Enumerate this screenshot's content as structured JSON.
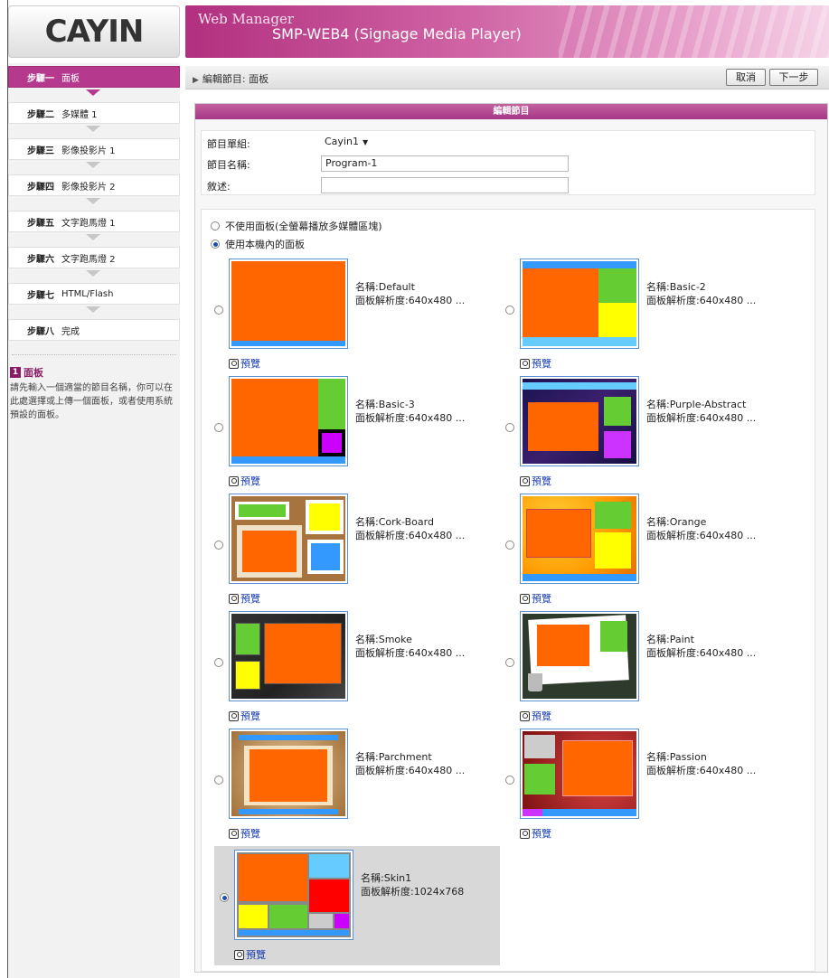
{
  "brand": {
    "logo_text": "CAYIN",
    "title": "Web Manager",
    "subtitle": "SMP-WEB4 (Signage Media Player)"
  },
  "steps": [
    {
      "num": "步驟一",
      "label": "面板",
      "active": true
    },
    {
      "num": "步驟二",
      "label": "多媒體 1"
    },
    {
      "num": "步驟三",
      "label": "影像投影片 1"
    },
    {
      "num": "步驟四",
      "label": "影像投影片 2"
    },
    {
      "num": "步驟五",
      "label": "文字跑馬燈 1"
    },
    {
      "num": "步驟六",
      "label": "文字跑馬燈 2"
    },
    {
      "num": "步驟七",
      "label": "HTML/Flash"
    },
    {
      "num": "步驟八",
      "label": "完成"
    }
  ],
  "help": {
    "badge": "1",
    "title": "面板",
    "text": "請先輸入一個適當的節目名稱，你可以在此處選擇或上傳一個面板，或者使用系統預設的面板。"
  },
  "topbar": {
    "breadcrumb": "編輯節目: 面板",
    "cancel": "取消",
    "next": "下一步"
  },
  "panel": {
    "header": "編輯節目"
  },
  "form": {
    "group_label": "節目單組:",
    "group_value": "Cayin1",
    "name_label": "節目名稱:",
    "name_value": "Program-1",
    "desc_label": "敘述:",
    "desc_value": ""
  },
  "options": {
    "no_panel": "不使用面板(全螢幕播放多媒體區塊)",
    "use_panel": "使用本機內的面板",
    "preview_label": "預覽",
    "name_prefix": "名稱:",
    "res_prefix": "面板解析度:"
  },
  "templates": [
    {
      "name": "Default",
      "resolution": "640x480 ..."
    },
    {
      "name": "Basic-2",
      "resolution": "640x480 ..."
    },
    {
      "name": "Basic-3",
      "resolution": "640x480 ..."
    },
    {
      "name": "Purple-Abstract",
      "resolution": "640x480 ..."
    },
    {
      "name": "Cork-Board",
      "resolution": "640x480 ..."
    },
    {
      "name": "Orange",
      "resolution": "640x480 ..."
    },
    {
      "name": "Smoke",
      "resolution": "640x480 ..."
    },
    {
      "name": "Paint",
      "resolution": "640x480 ..."
    },
    {
      "name": "Parchment",
      "resolution": "640x480 ..."
    },
    {
      "name": "Passion",
      "resolution": "640x480 ..."
    },
    {
      "name": "Skin1",
      "resolution": "1024x768",
      "selected": true
    }
  ],
  "colors": {
    "accent": "#b53a8e",
    "orange": "#ff6600",
    "green": "#66cc33",
    "yellow": "#ffff00",
    "blue": "#3399ff",
    "purple": "#cc33ff",
    "red": "#ff0000",
    "lightblue": "#66ccff",
    "grey": "#cccccc"
  }
}
